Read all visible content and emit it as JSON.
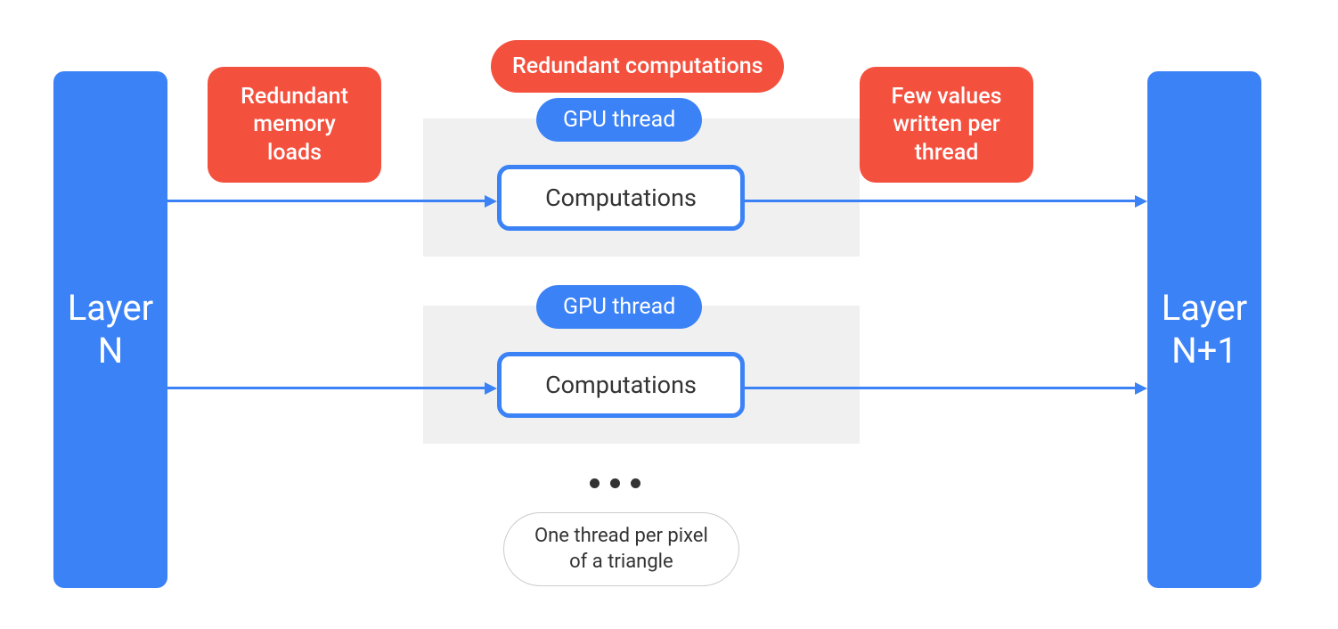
{
  "layers": {
    "left": "Layer\nN",
    "right": "Layer\nN+1"
  },
  "callouts": {
    "redundant_memory": "Redundant\nmemory\nloads",
    "redundant_computations": "Redundant computations",
    "few_values": "Few values\nwritten per\nthread"
  },
  "threads": {
    "label": "GPU thread",
    "computation": "Computations"
  },
  "footer": {
    "ellipsis": "…",
    "caption": "One thread per pixel\nof a triangle"
  },
  "colors": {
    "blue": "#3b82f6",
    "red": "#f4503e",
    "gray": "#f0f0f0"
  }
}
